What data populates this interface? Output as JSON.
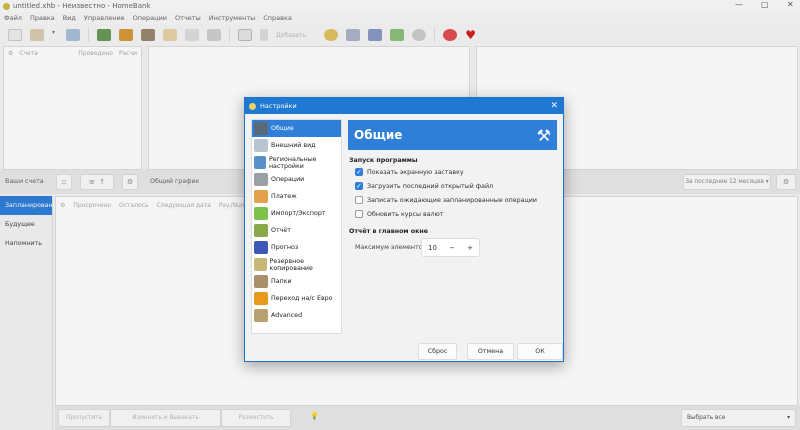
{
  "window": {
    "title": "untitled.xhb - Неизвестно - HomeBank",
    "controls": [
      "—",
      "▢",
      "✕"
    ]
  },
  "menu": [
    "Файл",
    "Правка",
    "Вид",
    "Управление",
    "Операции",
    "Отчеты",
    "Инструменты",
    "Справка"
  ],
  "toolbar": {
    "add_label": "Добавить",
    "icons": [
      "new-file",
      "open-folder",
      "dropdown",
      "save",
      "accounts",
      "payees",
      "categories",
      "budget",
      "archive",
      "assign",
      "book",
      "add",
      "statistics",
      "trend",
      "balance",
      "vehicle-cost",
      "converter",
      "help",
      "donate"
    ]
  },
  "accounts_panel": {
    "columns": [
      "Счета",
      "Проведено",
      "Расчи"
    ],
    "footer_label": "Ваши счета"
  },
  "chart_panel": {
    "footer_label": "Общий график",
    "range_select": "За последние 12 месяцев"
  },
  "lower": {
    "tabs": [
      "Запланировано",
      "Будущее",
      "Напомнить"
    ],
    "columns": [
      "Просрочено",
      "Осталось",
      "Следующая дата",
      "Pay./Number"
    ],
    "buttons": [
      "Пропустить",
      "Изменить и Вывакать",
      "Разместить"
    ],
    "select_all": "Выбрать все"
  },
  "dialog": {
    "title": "Настройки",
    "nav": [
      {
        "label": "Общие",
        "icon": "wrench-icon",
        "color": "#5b6a7a"
      },
      {
        "label": "Внешний вид",
        "icon": "window-icon",
        "color": "#b8c4d0"
      },
      {
        "label": "Региональные настройки",
        "icon": "flag-icon",
        "color": "#5b8fc8"
      },
      {
        "label": "Операции",
        "icon": "list-icon",
        "color": "#9aa0a6"
      },
      {
        "label": "Платеж",
        "icon": "payment-icon",
        "color": "#e3a14b"
      },
      {
        "label": "Импорт/Экспорт",
        "icon": "import-export-icon",
        "color": "#7cc24b"
      },
      {
        "label": "Отчёт",
        "icon": "report-icon",
        "color": "#8aa848"
      },
      {
        "label": "Прогноз",
        "icon": "forecast-icon",
        "color": "#3d56b8"
      },
      {
        "label": "Резервное копирование",
        "icon": "clock-icon",
        "color": "#c9b77a"
      },
      {
        "label": "Папки",
        "icon": "folder-icon",
        "color": "#a8916a"
      },
      {
        "label": "Переход на/с Евро",
        "icon": "euro-icon",
        "color": "#e89a1c"
      },
      {
        "label": "Advanced",
        "icon": "advanced-icon",
        "color": "#b8a070"
      }
    ],
    "header": "Общие",
    "startup_section": "Запуск программы",
    "options": [
      {
        "label": "Показать экранную заставку",
        "checked": true
      },
      {
        "label": "Загрузить последний открытый файл",
        "checked": true
      },
      {
        "label": "Записать ожидающие запланированные операции",
        "checked": false
      },
      {
        "label": "Обновить курсы валют",
        "checked": false
      }
    ],
    "main_window_section": "Отчёт в главном окне",
    "max_items_label": "Максимум элементов:",
    "max_items_value": "10",
    "buttons": {
      "reset": "Сброс",
      "cancel": "Отмена",
      "ok": "ОК"
    }
  },
  "colors": {
    "accent": "#2f7ed8"
  }
}
